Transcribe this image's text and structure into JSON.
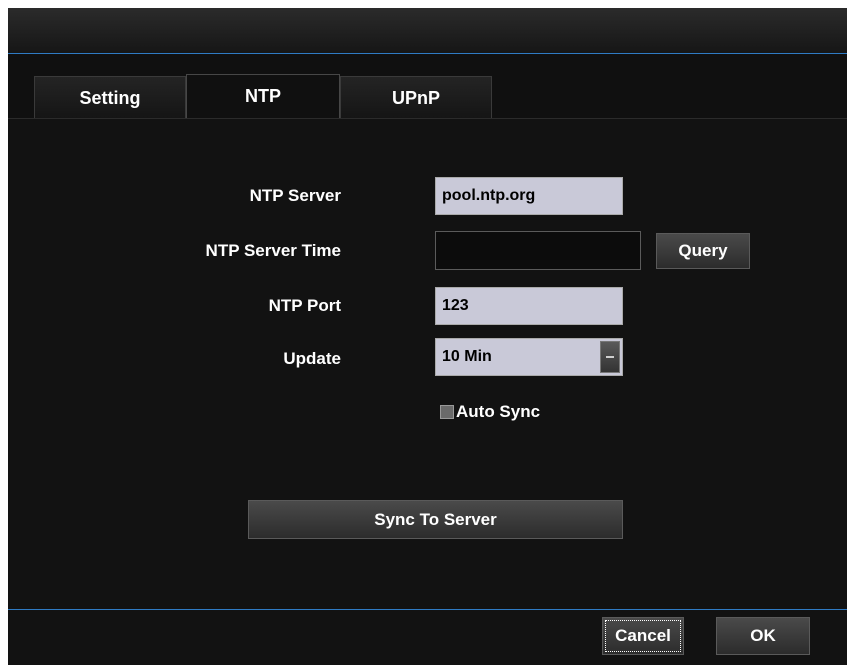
{
  "tabs": [
    {
      "label": "Setting"
    },
    {
      "label": "NTP"
    },
    {
      "label": "UPnP"
    }
  ],
  "active_tab": "NTP",
  "form": {
    "ntp_server": {
      "label": "NTP Server",
      "value": "pool.ntp.org"
    },
    "ntp_server_time": {
      "label": "NTP Server Time",
      "value": ""
    },
    "query_button": "Query",
    "ntp_port": {
      "label": "NTP Port",
      "value": "123"
    },
    "update": {
      "label": "Update",
      "value": "10 Min"
    },
    "auto_sync": {
      "label": "Auto Sync",
      "checked": false
    },
    "sync_button": "Sync To Server"
  },
  "footer": {
    "cancel": "Cancel",
    "ok": "OK"
  },
  "colors": {
    "accent": "#2f7bc4",
    "field_bg": "#c9c9d8",
    "dialog_bg": "#101010"
  }
}
